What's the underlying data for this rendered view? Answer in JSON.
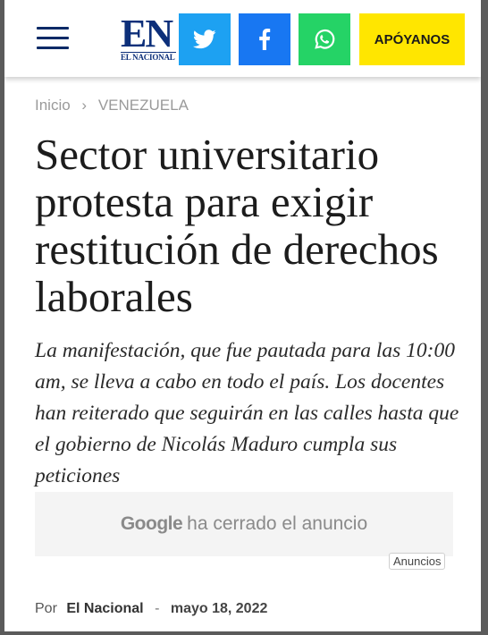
{
  "header": {
    "logo_main": "EN",
    "logo_sub": "EL NACIONAL",
    "support_label": "APÓYANOS"
  },
  "breadcrumb": {
    "home": "Inicio",
    "separator": "›",
    "section": "VENEZUELA"
  },
  "article": {
    "title": "Sector universitario protesta para exigir restitución de derechos laborales",
    "lead": "La manifestación, que fue pautada para las 10:00 am, se lleva a cabo en todo el país. Los docentes han reiterado que seguirán en las calles hasta que el gobierno de Nicolás Maduro cumpla sus peticiones",
    "byline_prefix": "Por",
    "author": "El Nacional",
    "byline_sep": "-",
    "date": "mayo 18, 2022"
  },
  "ad": {
    "brand": "Google",
    "message": "ha cerrado el anuncio",
    "tag": "Anuncios"
  },
  "icons": {
    "menu": "hamburger-icon",
    "twitter": "twitter-icon",
    "facebook": "facebook-icon",
    "whatsapp": "whatsapp-icon"
  },
  "colors": {
    "twitter": "#1da1f2",
    "facebook": "#1877f2",
    "whatsapp": "#25d366",
    "support": "#ffe600",
    "brand_navy": "#0c2f7a"
  }
}
